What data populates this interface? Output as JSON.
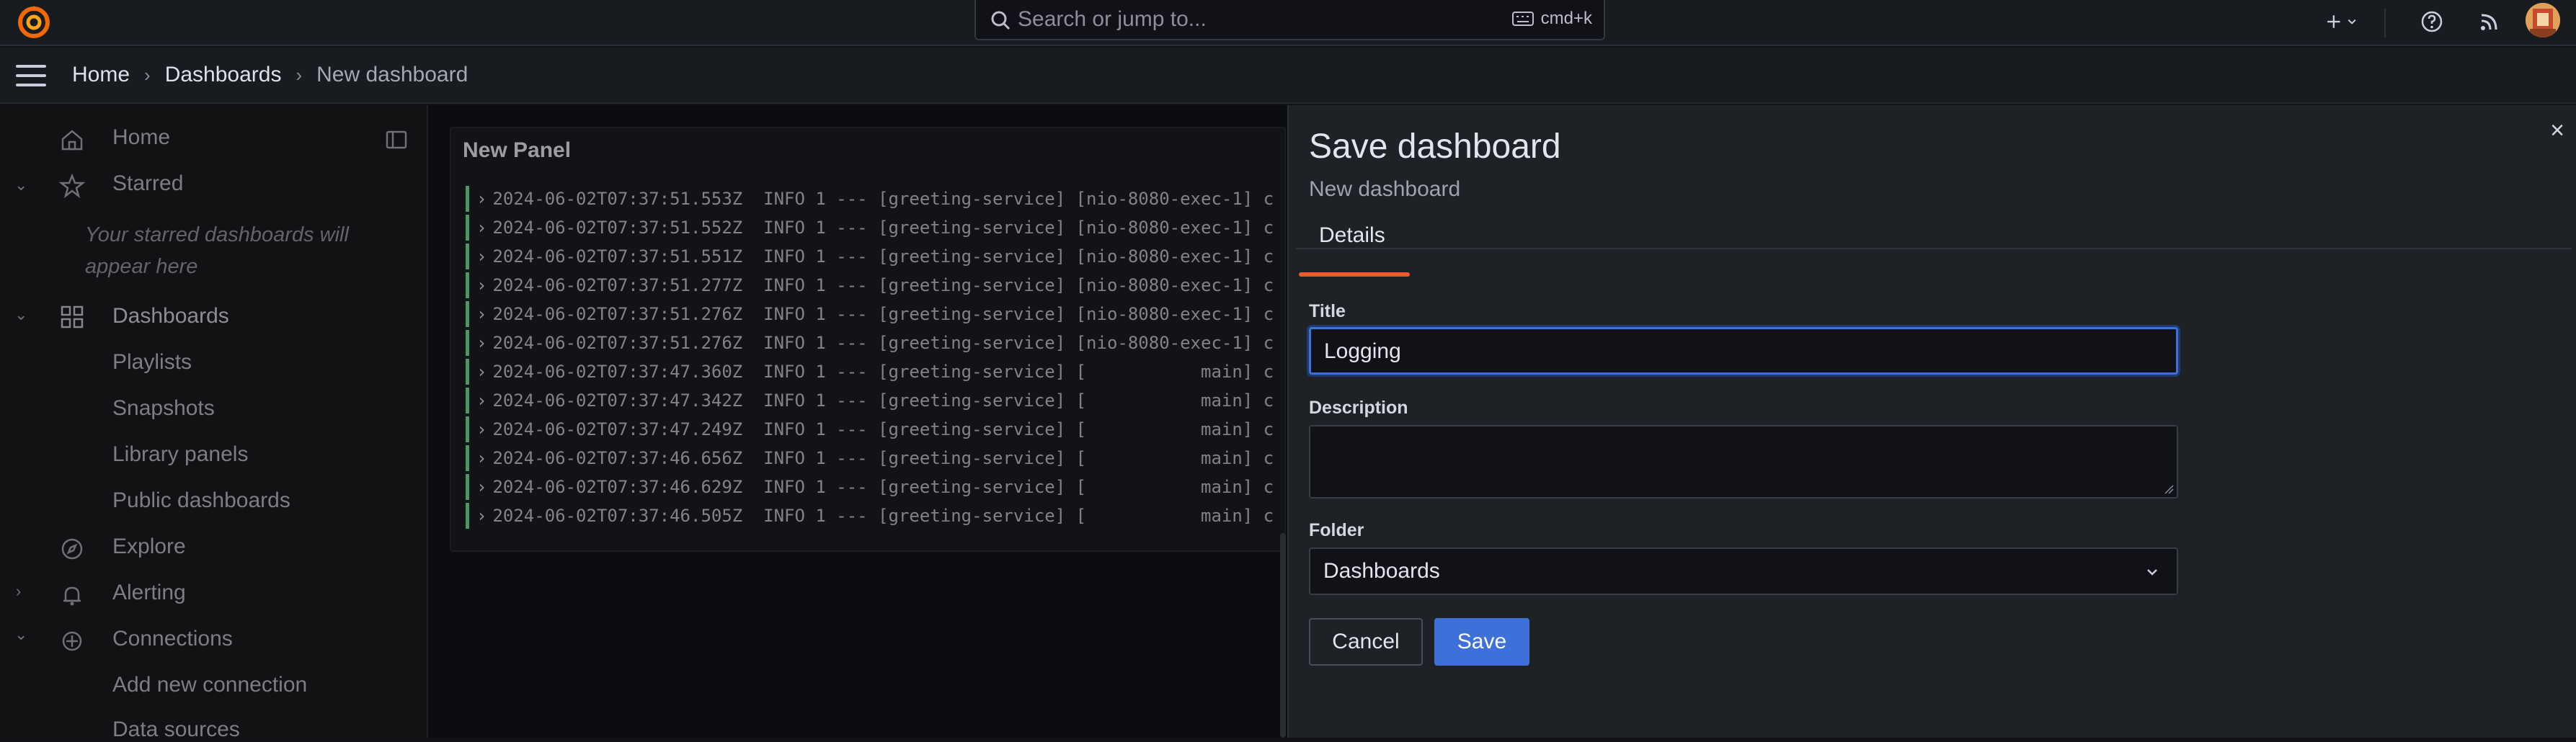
{
  "topbar": {
    "search_placeholder": "Search or jump to...",
    "search_shortcut": "cmd+k",
    "icons": [
      "grafana-logo-icon",
      "search-icon",
      "keyboard-icon",
      "plus-icon",
      "chevron-down-icon",
      "help-icon",
      "rss-icon",
      "avatar"
    ]
  },
  "breadcrumb": {
    "items": [
      "Home",
      "Dashboards",
      "New dashboard"
    ]
  },
  "sidebar": {
    "home": "Home",
    "starred": "Starred",
    "starred_empty_line1": "Your starred dashboards will",
    "starred_empty_line2": "appear here",
    "dashboards": "Dashboards",
    "playlists": "Playlists",
    "snapshots": "Snapshots",
    "library_panels": "Library panels",
    "public_dashboards": "Public dashboards",
    "explore": "Explore",
    "alerting": "Alerting",
    "connections": "Connections",
    "add_new_connection": "Add new connection",
    "data_sources": "Data sources"
  },
  "panel": {
    "title": "New Panel",
    "log_lines": [
      "2024-06-02T07:37:51.553Z  INFO 1 --- [greeting-service] [nio-8080-exec-1] c",
      "2024-06-02T07:37:51.552Z  INFO 1 --- [greeting-service] [nio-8080-exec-1] c",
      "2024-06-02T07:37:51.551Z  INFO 1 --- [greeting-service] [nio-8080-exec-1] c",
      "2024-06-02T07:37:51.277Z  INFO 1 --- [greeting-service] [nio-8080-exec-1] c",
      "2024-06-02T07:37:51.276Z  INFO 1 --- [greeting-service] [nio-8080-exec-1] c",
      "2024-06-02T07:37:51.276Z  INFO 1 --- [greeting-service] [nio-8080-exec-1] c",
      "2024-06-02T07:37:47.360Z  INFO 1 --- [greeting-service] [           main] c",
      "2024-06-02T07:37:47.342Z  INFO 1 --- [greeting-service] [           main] c",
      "2024-06-02T07:37:47.249Z  INFO 1 --- [greeting-service] [           main] c",
      "2024-06-02T07:37:46.656Z  INFO 1 --- [greeting-service] [           main] c",
      "2024-06-02T07:37:46.629Z  INFO 1 --- [greeting-service] [           main] c",
      "2024-06-02T07:37:46.505Z  INFO 1 --- [greeting-service] [           main] c"
    ]
  },
  "drawer": {
    "title": "Save dashboard",
    "subtitle": "New dashboard",
    "tab_details": "Details",
    "title_label": "Title",
    "title_value": "Logging",
    "description_label": "Description",
    "description_value": "",
    "folder_label": "Folder",
    "folder_value": "Dashboards",
    "cancel_label": "Cancel",
    "save_label": "Save",
    "close_label": "×"
  },
  "colors": {
    "accent_blue": "#3d71d9",
    "tab_orange": "#f05a28",
    "log_green": "#6ccf8e"
  }
}
